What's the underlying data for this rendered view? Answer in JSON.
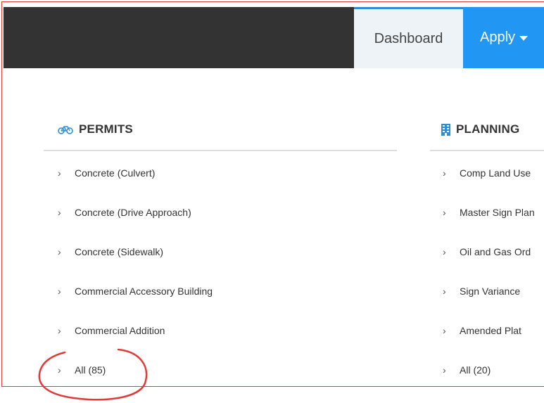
{
  "nav": {
    "dashboard_label": "Dashboard",
    "apply_label": "Apply"
  },
  "permits": {
    "title": "PERMITS",
    "icon": "bicycle-icon",
    "items": [
      {
        "label": "Concrete (Culvert)"
      },
      {
        "label": "Concrete (Drive Approach)"
      },
      {
        "label": "Concrete (Sidewalk)"
      },
      {
        "label": "Commercial Accessory Building"
      },
      {
        "label": "Commercial Addition"
      },
      {
        "label": "All (85)"
      }
    ]
  },
  "planning": {
    "title": "PLANNING",
    "icon": "building-icon",
    "items": [
      {
        "label": "Comp Land Use"
      },
      {
        "label": "Master Sign Plan"
      },
      {
        "label": "Oil and Gas Ord"
      },
      {
        "label": "Sign Variance"
      },
      {
        "label": "Amended Plat"
      },
      {
        "label": "All (20)"
      }
    ]
  },
  "colors": {
    "topbar": "#333333",
    "accent": "#2196f3",
    "annotation": "#e53935"
  }
}
